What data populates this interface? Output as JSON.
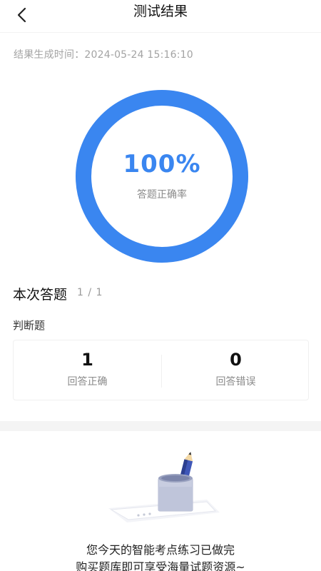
{
  "nav": {
    "title": "测试结果",
    "back_icon": "chevron-left-icon"
  },
  "result": {
    "generated_label": "结果生成时间：2024-05-24 15:16:10",
    "accuracy_text": "100%",
    "accuracy_fraction": 1.0,
    "accuracy_label": "答题正确率",
    "accent_color": "#3a86f0"
  },
  "summary": {
    "title": "本次答题",
    "count": "1 / 1",
    "question_type": "判断题",
    "correct_value": "1",
    "correct_label": "回答正确",
    "wrong_value": "0",
    "wrong_label": "回答错误"
  },
  "footer": {
    "illustration_icon": "pencil-cup-icon",
    "line1": "您今天的智能考点练习已做完",
    "line2": "购买题库即可享受海量试题资源~"
  }
}
